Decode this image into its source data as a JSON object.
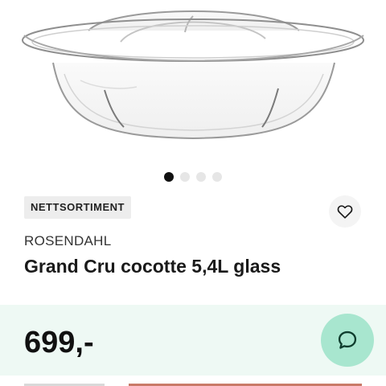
{
  "product": {
    "image_icon": "glass-cocotte-with-lid",
    "badge": "NETTSORTIMENT",
    "brand": "ROSENDAHL",
    "title": "Grand Cru cocotte 5,4L glass",
    "price": "699,-"
  },
  "carousel": {
    "total": 4,
    "active": 1
  },
  "icons": {
    "favorite": "heart-icon",
    "chat": "chat-bubble-icon"
  },
  "colors": {
    "price_band": "#eef9f4",
    "chat_button": "#a8e6cf",
    "badge_bg": "#ededed",
    "active_dot": "#111111",
    "inactive_dot": "#e6e6e6"
  }
}
